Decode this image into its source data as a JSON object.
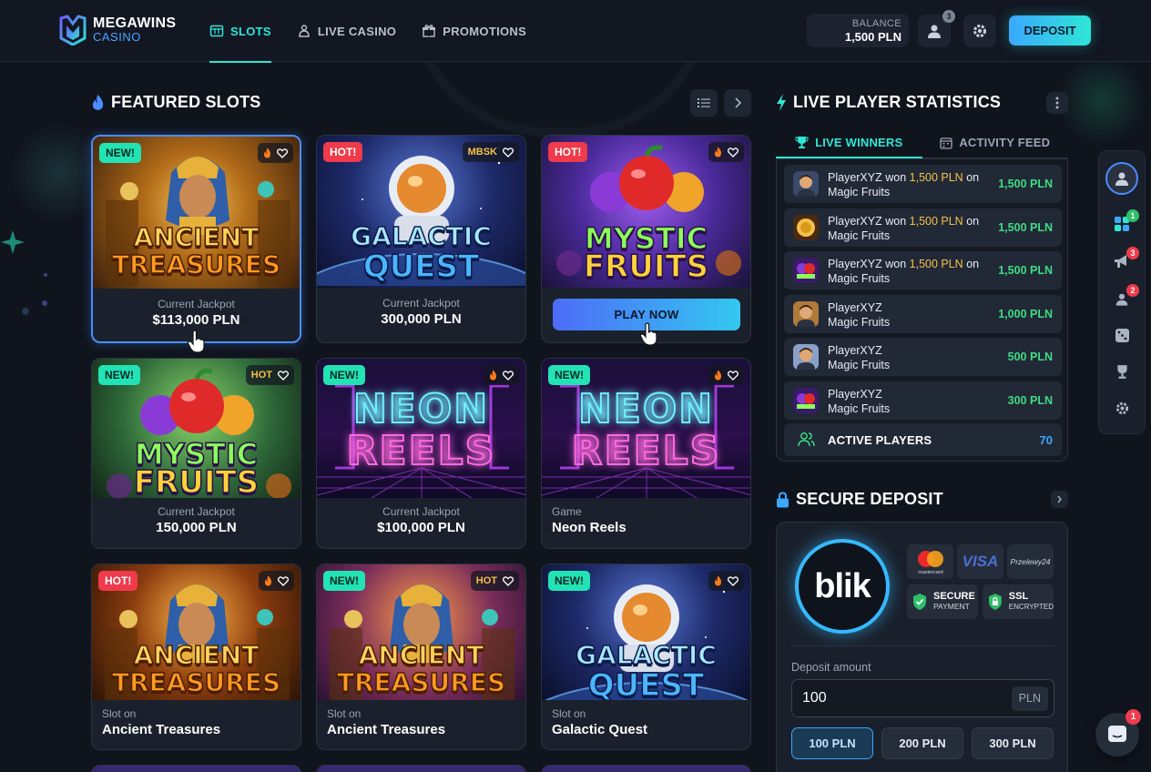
{
  "brand": {
    "name": "MEGAWINS",
    "sub": "CASINO"
  },
  "nav": [
    {
      "label": "SLOTS",
      "active": true
    },
    {
      "label": "LIVE CASINO",
      "active": false
    },
    {
      "label": "PROMOTIONS",
      "active": false
    }
  ],
  "header": {
    "balance_label": "BALANCE",
    "balance_value": "1,500 PLN",
    "profile_badge": "3",
    "deposit_label": "DEPOSIT"
  },
  "featured": {
    "title": "FEATURED SLOTS",
    "cards": [
      {
        "badge": "NEW!",
        "title1": "ANCIENT",
        "title2": "TREASURES",
        "theme": "egypt",
        "foot_label": "Current Jackpot",
        "foot_value": "$113,000 PLN",
        "pill": ""
      },
      {
        "badge": "HOT!",
        "title1": "GALACTIC",
        "title2": "QUEST",
        "theme": "space",
        "foot_label": "Current Jackpot",
        "foot_value": "300,000 PLN",
        "pill": "MBSK"
      },
      {
        "badge": "HOT!",
        "title1": "MYSTIC",
        "title2": "FRUITS",
        "theme": "fruits",
        "play_label": "PLAY NOW",
        "pill": ""
      },
      {
        "badge": "NEW!",
        "title1": "MYSTIC",
        "title2": "FRUITS",
        "theme": "fruits2",
        "foot_label": "Current Jackpot",
        "foot_value": "150,000 PLN",
        "pill": "HOT"
      },
      {
        "badge": "NEW!",
        "title1": "NEON",
        "title2": "REELS",
        "theme": "neon",
        "foot_label": "Current Jackpot",
        "foot_value": "$100,000 PLN",
        "pill": ""
      },
      {
        "badge": "NEW!",
        "title1": "NEON",
        "title2": "REELS",
        "theme": "neon",
        "slot_label": "Game",
        "slot_name": "Neon Reels",
        "pill": ""
      },
      {
        "badge": "HOT!",
        "title1": "ANCIENT",
        "title2": "TREASURES",
        "theme": "egypt2",
        "slot_label": "Slot on",
        "slot_name": "Ancient Treasures",
        "pill": ""
      },
      {
        "badge": "NEW!",
        "title1": "ANCIENT",
        "title2": "TREASURES",
        "theme": "egypt3",
        "slot_label": "Slot on",
        "slot_name": "Ancient Treasures",
        "pill": "HOT"
      },
      {
        "badge": "NEW!",
        "title1": "GALACTIC",
        "title2": "QUEST",
        "theme": "space",
        "slot_label": "Slot on",
        "slot_name": "Galactic Quest",
        "pill": ""
      }
    ]
  },
  "stats": {
    "title": "LIVE PLAYER STATISTICS",
    "tabs": [
      "LIVE WINNERS",
      "ACTIVITY FEED"
    ],
    "winners": [
      {
        "player": "PlayerXYZ",
        "pre": " won ",
        "amt": "1,500 PLN",
        "post": " on",
        "game": "Magic Fruits",
        "value": "1,500 PLN",
        "avatar": "man"
      },
      {
        "player": "PlayerXYZ",
        "pre": " won ",
        "amt": "1,500 PLN",
        "post": " on",
        "game": "Magic Fruits",
        "value": "1,500 PLN",
        "avatar": "coin"
      },
      {
        "player": "PlayerXYZ",
        "pre": " won ",
        "amt": "1,500 PLN",
        "post": " on",
        "game": "Magic Fruits",
        "value": "1,500 PLN",
        "avatar": "fruit"
      },
      {
        "player": "PlayerXYZ",
        "pre": "",
        "amt": "",
        "post": "",
        "game": "Magic Fruits",
        "value": "1,000 PLN",
        "avatar": "man2"
      },
      {
        "player": "PlayerXYZ",
        "pre": "",
        "amt": "",
        "post": "",
        "game": "Magic Fruits",
        "value": "500 PLN",
        "avatar": "man3"
      },
      {
        "player": "PlayerXYZ",
        "pre": "",
        "amt": "",
        "post": "",
        "game": "Magic Fruits",
        "value": "300 PLN",
        "avatar": "fruit"
      }
    ],
    "active_label": "ACTIVE PLAYERS",
    "active_value": "70"
  },
  "deposit": {
    "title": "SECURE DEPOSIT",
    "blik": "blik",
    "visa": "VISA",
    "przelewy": "Przelewy24",
    "mastercard": "mastercard",
    "secure1": "SECURE",
    "secure2": "PAYMENT",
    "ssl1": "SSL",
    "ssl2": "ENCRYPTED",
    "amount_label": "Deposit amount",
    "amount_value": "100",
    "unit": "PLN",
    "presets": [
      "100 PLN",
      "200 PLN",
      "300 PLN"
    ],
    "selected_preset": "100 PLN"
  },
  "rail": {
    "badges": [
      "1",
      "3",
      "2"
    ]
  },
  "chat": {
    "badge": "1"
  },
  "colors": {
    "accent": "#2ee6d6",
    "primary": "#3aa8ff",
    "win": "#3ddc84",
    "gold": "#f5c14a",
    "hot": "#ef3b4c",
    "new": "#22e3b4"
  }
}
